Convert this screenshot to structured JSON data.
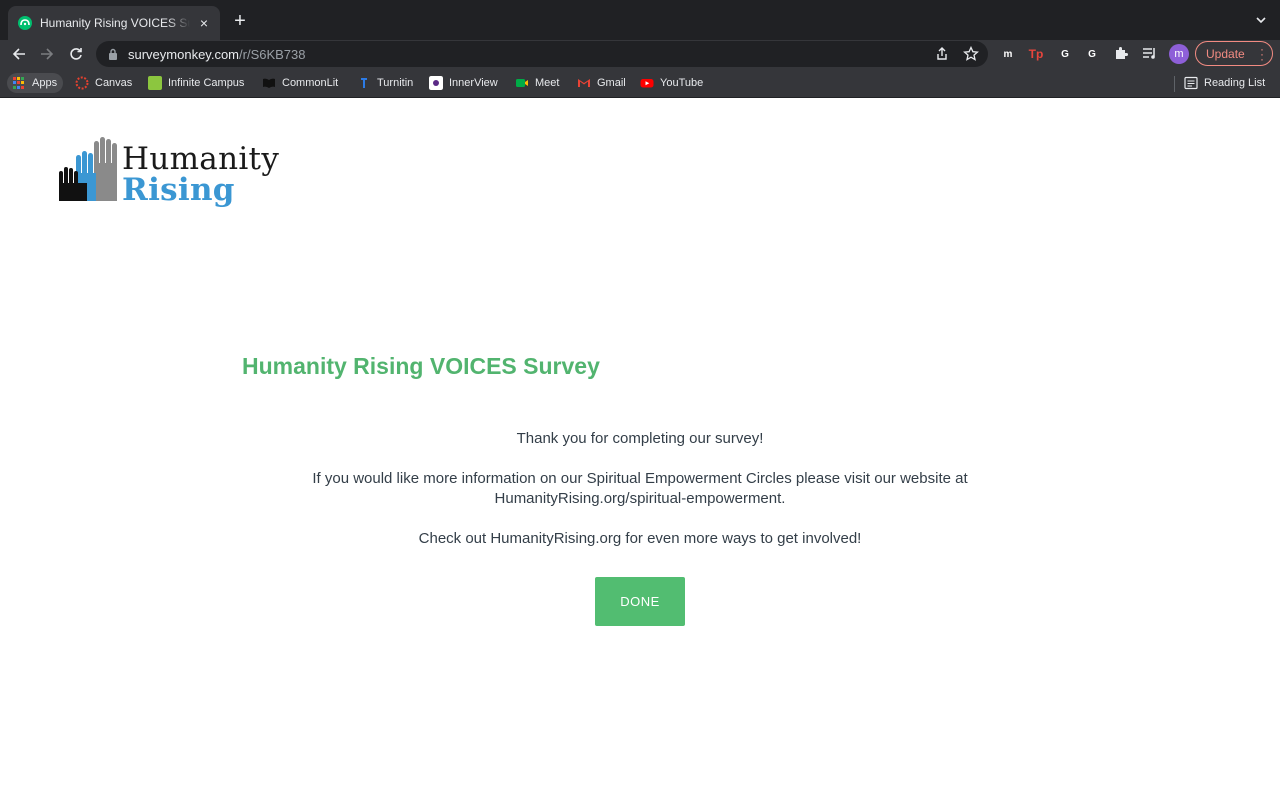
{
  "browser": {
    "tab": {
      "title": "Humanity Rising VOICES Survey",
      "close": "×"
    },
    "new_tab": "+",
    "url": {
      "host": "surveymonkey.com",
      "path": "/r/S6KB738"
    },
    "update_label": "Update",
    "profile_initial": "m",
    "extensions": [
      {
        "name": "m-extension",
        "letter": "m",
        "color": "#19a0a6"
      },
      {
        "name": "tp-extension",
        "letter": "Tp",
        "color": "#e8453c"
      },
      {
        "name": "grammarly-extension",
        "letter": "G",
        "color": "#15c39a"
      },
      {
        "name": "g-extension",
        "letter": "G",
        "color": "#8a8a8a"
      }
    ],
    "bookmarks": [
      {
        "label": "Apps",
        "icon": "apps-grid-icon"
      },
      {
        "label": "Canvas",
        "icon": "canvas-icon",
        "color": "#e4412f"
      },
      {
        "label": "Infinite Campus",
        "icon": "infinite-campus-icon",
        "color": "#8cc63f"
      },
      {
        "label": "CommonLit",
        "icon": "commonlit-icon",
        "color": "#111111"
      },
      {
        "label": "Turnitin",
        "icon": "turnitin-icon",
        "color": "#2c7be5"
      },
      {
        "label": "InnerView",
        "icon": "innerview-icon",
        "color": "#ffffff"
      },
      {
        "label": "Meet",
        "icon": "meet-icon",
        "color": "#00ac47"
      },
      {
        "label": "Gmail",
        "icon": "gmail-icon",
        "color": "#ea4335"
      },
      {
        "label": "YouTube",
        "icon": "youtube-icon",
        "color": "#ff0000"
      }
    ],
    "reading_list": "Reading List"
  },
  "page": {
    "logo": {
      "line1": "Humanity",
      "line2": "Rising"
    },
    "survey_title": "Humanity Rising VOICES Survey",
    "message": {
      "thanks": "Thank you for completing our survey!",
      "info_line1": "If you would like more information on our Spiritual Empowerment Circles please visit our website at",
      "info_line2": "HumanityRising.org/spiritual-empowerment.",
      "checkout": "Check out HumanityRising.org for even more ways to get involved!"
    },
    "done_label": "DONE"
  },
  "colors": {
    "title_green": "#52b46f",
    "button_green": "#52bd71",
    "logo_blue": "#3b97d3"
  }
}
